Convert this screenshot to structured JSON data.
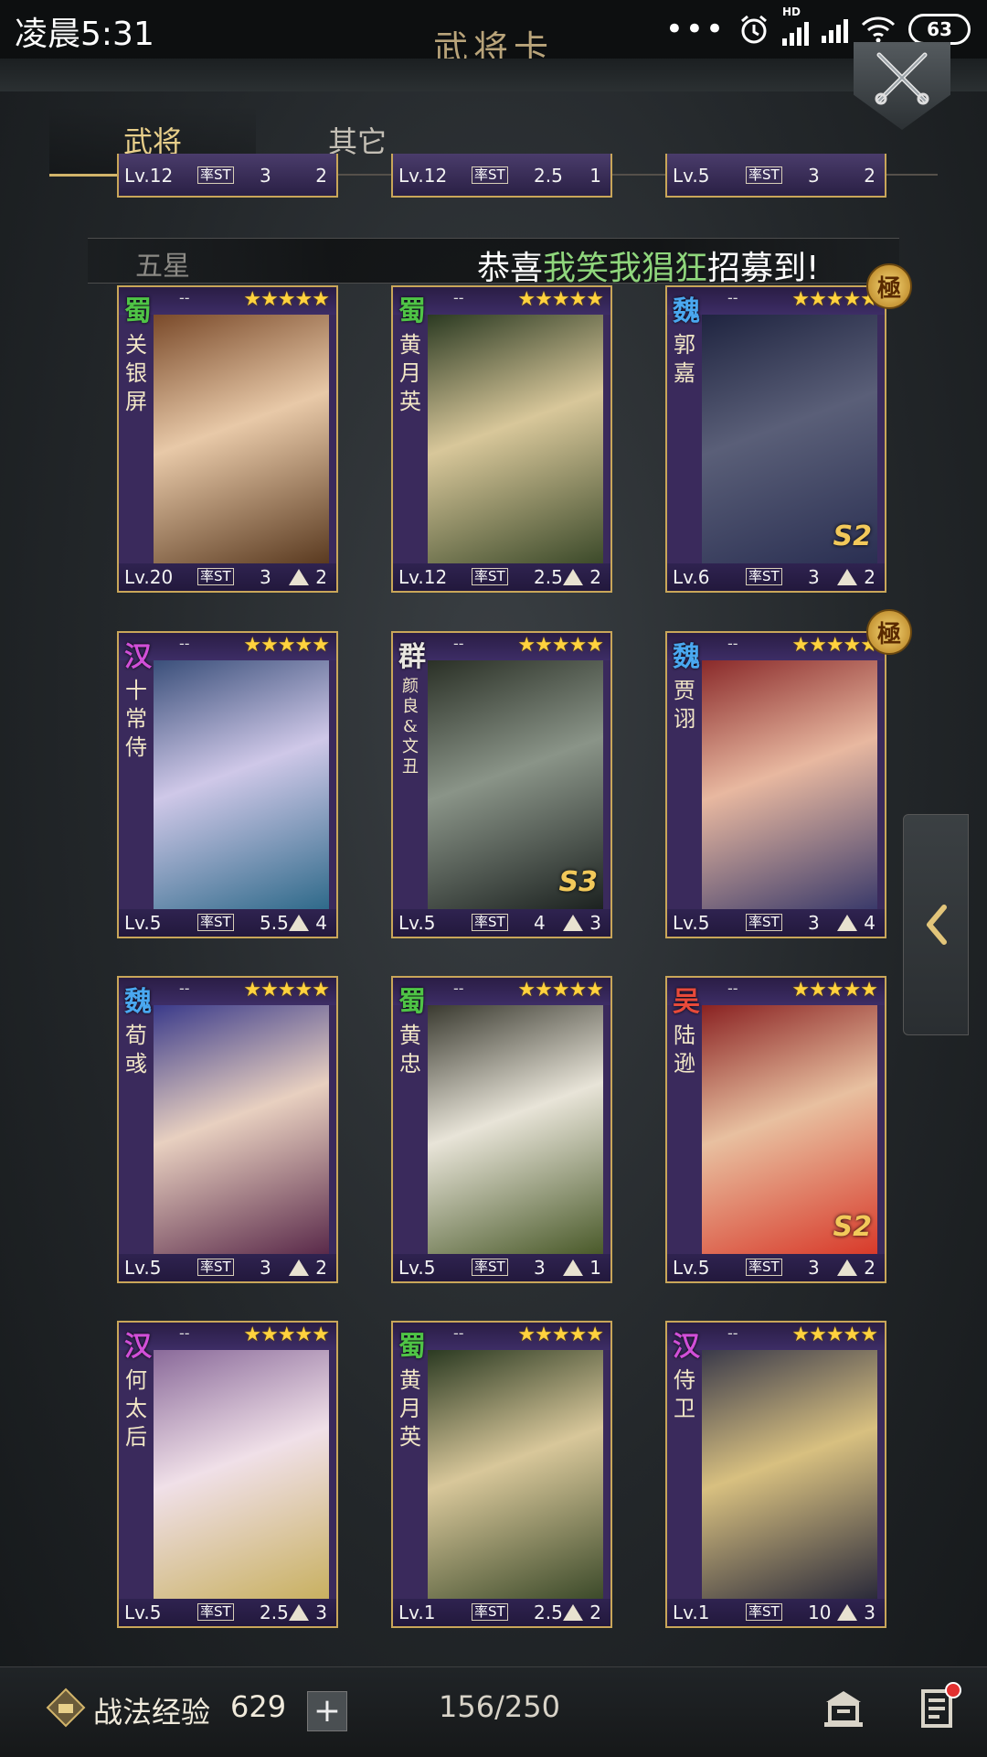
{
  "status_bar": {
    "time": "凌晨5:31",
    "battery": "63",
    "network": "HD"
  },
  "header": {
    "title": "武将卡"
  },
  "tabs": [
    {
      "label": "武将"
    },
    {
      "label": "其它"
    }
  ],
  "partial_row": [
    {
      "level": "Lv.12",
      "rate_label": "率ST",
      "rate": "3",
      "count": "2"
    },
    {
      "level": "Lv.12",
      "rate_label": "率ST",
      "rate": "2.5",
      "count": "1"
    },
    {
      "level": "Lv.5",
      "rate_label": "率ST",
      "rate": "3",
      "count": "2"
    }
  ],
  "section": {
    "label": "五星",
    "marquee_prefix": "恭喜",
    "marquee_player": "我笑我猖狂",
    "marquee_suffix": "招募到!"
  },
  "cards": [
    {
      "kingdom": "蜀",
      "kingdom_color": "#4fc446",
      "name": "关银屏",
      "stars": "★★★★★",
      "dash": "--",
      "level": "Lv.20",
      "rate_label": "率ST",
      "rate": "3",
      "count": "2",
      "rank": "",
      "badge": "",
      "art": [
        "#7a4a2a",
        "#e8c9a8",
        "#5a3a20"
      ]
    },
    {
      "kingdom": "蜀",
      "kingdom_color": "#4fc446",
      "name": "黄月英",
      "stars": "★★★★★",
      "dash": "--",
      "level": "Lv.12",
      "rate_label": "率ST",
      "rate": "2.5",
      "count": "2",
      "rank": "",
      "badge": "",
      "art": [
        "#2b3a22",
        "#d8c79a",
        "#3c4a2a"
      ]
    },
    {
      "kingdom": "魏",
      "kingdom_color": "#4aa8f0",
      "name": "郭嘉",
      "stars": "★★★★★",
      "dash": "--",
      "level": "Lv.6",
      "rate_label": "率ST",
      "rate": "3",
      "count": "2",
      "rank": "S2",
      "badge": "極",
      "art": [
        "#1f2440",
        "#5a5f78",
        "#2a2f52"
      ]
    },
    {
      "kingdom": "汉",
      "kingdom_color": "#d14fd8",
      "name": "十常侍",
      "stars": "★★★★★",
      "dash": "--",
      "level": "Lv.5",
      "rate_label": "率ST",
      "rate": "5.5",
      "count": "4",
      "rank": "",
      "badge": "",
      "art": [
        "#3a4f7a",
        "#cfc8e8",
        "#2f6a8a"
      ]
    },
    {
      "kingdom": "群",
      "kingdom_color": "#e8e6e0",
      "name": "颜良&文丑",
      "stars": "★★★★★",
      "dash": "--",
      "level": "Lv.5",
      "rate_label": "率ST",
      "rate": "4",
      "count": "3",
      "rank": "S3",
      "badge": "",
      "art": [
        "#2a3026",
        "#8a9488",
        "#1c2220"
      ]
    },
    {
      "kingdom": "魏",
      "kingdom_color": "#4aa8f0",
      "name": "贾诩",
      "stars": "★★★★★",
      "dash": "--",
      "level": "Lv.5",
      "rate_label": "率ST",
      "rate": "3",
      "count": "4",
      "rank": "",
      "badge": "極",
      "art": [
        "#8a2a2a",
        "#e8b8a0",
        "#3a3a6a"
      ]
    },
    {
      "kingdom": "魏",
      "kingdom_color": "#4aa8f0",
      "name": "荀彧",
      "stars": "★★★★★",
      "dash": "--",
      "level": "Lv.5",
      "rate_label": "率ST",
      "rate": "3",
      "count": "2",
      "rank": "",
      "badge": "",
      "art": [
        "#3a3a8a",
        "#e8d0c0",
        "#5a2a4a"
      ]
    },
    {
      "kingdom": "蜀",
      "kingdom_color": "#4fc446",
      "name": "黄忠",
      "stars": "★★★★★",
      "dash": "--",
      "level": "Lv.5",
      "rate_label": "率ST",
      "rate": "3",
      "count": "1",
      "rank": "",
      "badge": "",
      "art": [
        "#3a3a30",
        "#e8e4d8",
        "#4a5a2a"
      ]
    },
    {
      "kingdom": "吴",
      "kingdom_color": "#e84a3a",
      "name": "陆逊",
      "stars": "★★★★★",
      "dash": "--",
      "level": "Lv.5",
      "rate_label": "率ST",
      "rate": "3",
      "count": "2",
      "rank": "S2",
      "badge": "",
      "art": [
        "#8a2222",
        "#e8c0a0",
        "#d83a2a"
      ]
    },
    {
      "kingdom": "汉",
      "kingdom_color": "#d14fd8",
      "name": "何太后",
      "stars": "★★★★★",
      "dash": "--",
      "level": "Lv.5",
      "rate_label": "率ST",
      "rate": "2.5",
      "count": "3",
      "rank": "",
      "badge": "",
      "art": [
        "#8a6a9a",
        "#f0e0e8",
        "#c8b060"
      ]
    },
    {
      "kingdom": "蜀",
      "kingdom_color": "#4fc446",
      "name": "黄月英",
      "stars": "★★★★★",
      "dash": "--",
      "level": "Lv.1",
      "rate_label": "率ST",
      "rate": "2.5",
      "count": "2",
      "rank": "",
      "badge": "",
      "art": [
        "#2b3a22",
        "#d8c79a",
        "#3c4a2a"
      ]
    },
    {
      "kingdom": "汉",
      "kingdom_color": "#d14fd8",
      "name": "侍卫",
      "stars": "★★★★★",
      "dash": "--",
      "level": "Lv.1",
      "rate_label": "率ST",
      "rate": "10",
      "count": "3",
      "rank": "",
      "badge": "",
      "art": [
        "#3a3a4a",
        "#d8c080",
        "#2a2a3a"
      ]
    }
  ],
  "bottom_bar": {
    "exp_label": "战法经验",
    "exp_value": "629",
    "count_text": "156/250"
  }
}
